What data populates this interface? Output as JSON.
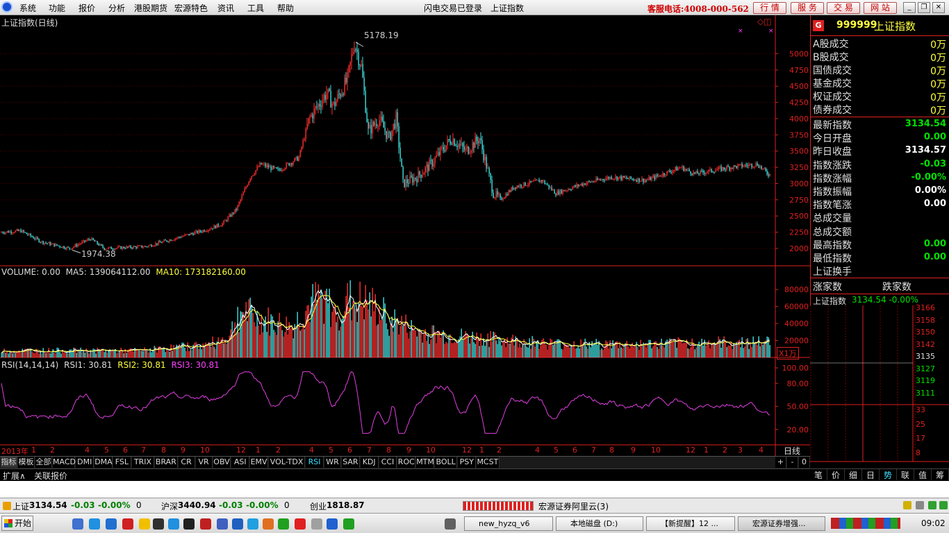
{
  "menubar": {
    "items": [
      "系统",
      "功能",
      "报价",
      "分析",
      "港股期货",
      "宏源特色",
      "资讯",
      "工具",
      "帮助"
    ],
    "status_login": "闪电交易已登录",
    "status_index": "上证指数",
    "hotline": "客服电话:4008-000-562",
    "quick": [
      "行 情",
      "服 务",
      "交 易",
      "网 站"
    ]
  },
  "chart": {
    "title": "上证指数(日线)",
    "high_label": "5178.19",
    "low_label": "1974.38",
    "markers": "◇◫"
  },
  "chart_data": [
    {
      "type": "candlestick",
      "ylim": [
        1850,
        5400
      ],
      "yticks": [
        2000,
        2250,
        2500,
        2750,
        3000,
        3250,
        3500,
        3750,
        4000,
        4250,
        4500,
        4750,
        5000
      ],
      "x": [
        "2013-01",
        "2013-07",
        "2014-01",
        "2014-07",
        "2014-10",
        "2015-01",
        "2015-04",
        "2015-06",
        "2015-07",
        "2015-09",
        "2015-12",
        "2016-01",
        "2016-03",
        "2016-06",
        "2016-12",
        "2017-04",
        "2017-12",
        "2018-03",
        "2018-04"
      ],
      "y": [
        2250,
        2000,
        2050,
        2100,
        2350,
        3250,
        4200,
        5100,
        3950,
        3050,
        3550,
        2900,
        2850,
        2950,
        3100,
        3200,
        3300,
        3200,
        3134.54
      ],
      "high": 5178.19,
      "low": 1974.38
    },
    {
      "type": "bar",
      "name": "VOLUME",
      "ylim": [
        0,
        90000
      ],
      "yticks": [
        20000,
        40000,
        60000,
        80000
      ],
      "unit": "X1万"
    },
    {
      "type": "line",
      "name": "RSI",
      "ylim": [
        0,
        110
      ],
      "yticks": [
        20.0,
        50.0,
        80.0,
        100.0
      ]
    }
  ],
  "volume": {
    "label": "VOLUME: 0.00",
    "ma5": "MA5: 139064112.00",
    "ma10": "MA10: 173182160.00",
    "unit": "X1万"
  },
  "rsi": {
    "label": "RSI(14,14,14)",
    "rsi1": "RSI1: 30.81",
    "rsi2": "RSI2: 30.81",
    "rsi3": "RSI3: 30.81"
  },
  "xaxis": {
    "year": "2013年",
    "months": [
      "1",
      "2",
      "4",
      "5",
      "6",
      "7",
      "8",
      "9",
      "10",
      "12",
      "1",
      "2",
      "4",
      "5",
      "6",
      "7",
      "8",
      "9",
      "10",
      "12",
      "1",
      "2",
      "4",
      "5",
      "6",
      "7",
      "8",
      "9",
      "10",
      "12",
      "1",
      "2",
      "3",
      "4"
    ],
    "period": "日线"
  },
  "tabs": [
    "指标",
    "模板",
    "全部",
    "MACD",
    "DMI",
    "DMA",
    "FSL",
    "TRIX",
    "BRAR",
    "CR",
    "VR",
    "OBV",
    "ASI",
    "EMV",
    "VOL-TDX",
    "RSI",
    "WR",
    "SAR",
    "KDJ",
    "CCI",
    "ROC",
    "MTM",
    "BOLL",
    "PSY",
    "MCST"
  ],
  "zoom": [
    "+",
    "-",
    "0"
  ],
  "subbar": {
    "expand": "扩展∧",
    "related": "关联报价"
  },
  "panel": {
    "badge": "G",
    "code": "999999",
    "name": "上证指数",
    "trade": [
      [
        "A股成交",
        "0万"
      ],
      [
        "B股成交",
        "0万"
      ],
      [
        "国债成交",
        "0万"
      ],
      [
        "基金成交",
        "0万"
      ],
      [
        "权证成交",
        "0万"
      ],
      [
        "债券成交",
        "0万"
      ]
    ],
    "quote": [
      [
        "最新指数",
        "3134.54",
        "#00e000"
      ],
      [
        "今日开盘",
        "0.00",
        "#00e000"
      ],
      [
        "昨日收盘",
        "3134.57",
        "#ffffff"
      ],
      [
        "指数涨跌",
        "-0.03",
        "#00e000"
      ],
      [
        "指数涨幅",
        "-0.00%",
        "#00e000"
      ],
      [
        "指数振幅",
        "0.00%",
        "#ffffff"
      ],
      [
        "指数笔涨",
        "0.00",
        "#ffffff"
      ],
      [
        "总成交量",
        "",
        ""
      ],
      [
        "总成交额",
        "",
        ""
      ],
      [
        "最高指数",
        "0.00",
        "#00e000"
      ],
      [
        "最低指数",
        "0.00",
        "#00e000"
      ],
      [
        "上证换手",
        "",
        ""
      ]
    ],
    "up": "涨家数",
    "down": "跌家数",
    "mini_name": "上证指数",
    "mini_val": "3134.54 -0.00%",
    "mini_axis": [
      "3166",
      "3158",
      "3150",
      "3142",
      "3135",
      "3127",
      "3119",
      "3111",
      "33",
      "25",
      "17",
      "8"
    ],
    "bottom_tabs": [
      "笔",
      "价",
      "细",
      "日",
      "势",
      "联",
      "值",
      "筹"
    ]
  },
  "status": {
    "sh_name": "上证",
    "sh_val": "3134.54",
    "sh_chg": "-0.03",
    "sh_pct": "-0.00%",
    "sh_vol": "0",
    "hs_name": "沪深",
    "hs_val": "3440.94",
    "hs_chg": "-0.03",
    "hs_pct": "-0.00%",
    "hs_vol": "0",
    "cy_name": "创业",
    "cy_val": "1818.87",
    "server": "宏源证券阿里云(3)"
  },
  "taskbar": {
    "start": "开始",
    "items": [
      "new_hyzq_v6",
      "本地磁盘 (D:)",
      "【新提醒】12 ...",
      "宏源证券增强..."
    ],
    "clock": "09:02"
  }
}
